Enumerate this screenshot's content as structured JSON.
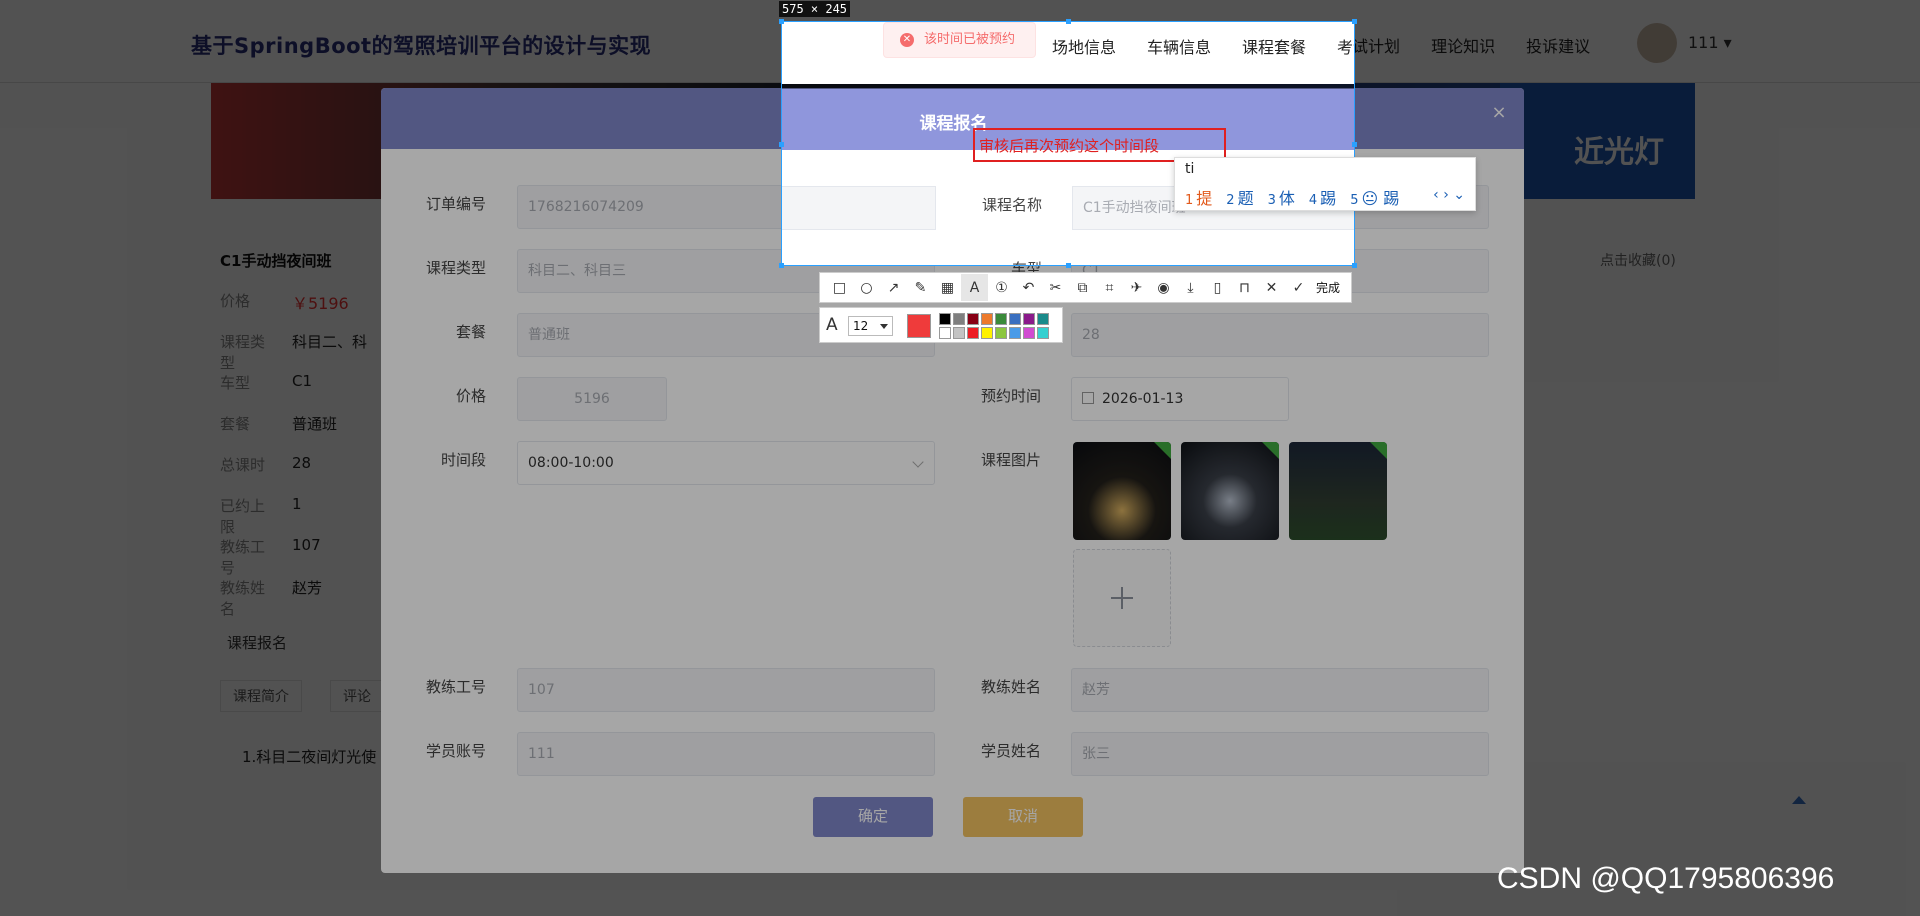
{
  "site": {
    "title": "基于SpringBoot的驾照培训平台的设计与实现",
    "nav": [
      "场地信息",
      "车辆信息",
      "课程套餐",
      "考试计划",
      "理论知识",
      "投诉建议"
    ],
    "user": "111 ▾"
  },
  "banner_text": "近光灯",
  "course": {
    "title": "C1手动挡夜间班",
    "details": [
      {
        "label": "价格",
        "value": "￥5196"
      },
      {
        "label": "课程类型",
        "value": "科目二、科"
      },
      {
        "label": "车型",
        "value": "C1"
      },
      {
        "label": "套餐",
        "value": "普通班"
      },
      {
        "label": "总课时",
        "value": "28"
      },
      {
        "label": "已约上限",
        "value": "1"
      },
      {
        "label": "教练工号",
        "value": "107"
      },
      {
        "label": "教练姓名",
        "value": "赵芳"
      }
    ],
    "section_title": "课程报名",
    "tabs": [
      "课程简介",
      "评论"
    ],
    "desc": "1.科目二夜间灯光使",
    "fav": "点击收藏(0)"
  },
  "dialog": {
    "title": "课程报名",
    "close": "×",
    "fields": {
      "order_no": {
        "label": "订单编号",
        "value": "1768216074209"
      },
      "course_name": {
        "label": "课程名称",
        "value": "C1手动挡夜间班"
      },
      "course_type": {
        "label": "课程类型",
        "value": "科目二、科目三"
      },
      "car_type": {
        "label": "车型",
        "value": "C1"
      },
      "package": {
        "label": "套餐",
        "value": "普通班"
      },
      "hours": {
        "label": "",
        "value": "28"
      },
      "price": {
        "label": "价格",
        "value": "5196"
      },
      "appt_time": {
        "label": "预约时间",
        "value": "2026-01-13"
      },
      "time_slot": {
        "label": "时间段",
        "value": "08:00-10:00"
      },
      "course_img": {
        "label": "课程图片"
      },
      "coach_id": {
        "label": "教练工号",
        "value": "107"
      },
      "coach_name": {
        "label": "教练姓名",
        "value": "赵芳"
      },
      "student_acc": {
        "label": "学员账号",
        "value": "111"
      },
      "student_name": {
        "label": "学员姓名",
        "value": "张三"
      }
    },
    "confirm": "确定",
    "cancel": "取消"
  },
  "toast": {
    "text": "该时间已被预约",
    "icon": "error-icon"
  },
  "screenshot_tool": {
    "size_label": "575 × 245",
    "annotation_text": "审核后再次预约这个时间段",
    "ime": {
      "input": "ti",
      "candidates": [
        {
          "n": "1",
          "text": "提"
        },
        {
          "n": "2",
          "text": "题"
        },
        {
          "n": "3",
          "text": "体"
        },
        {
          "n": "4",
          "text": "踢"
        },
        {
          "n": "5",
          "text": "😐 踢"
        }
      ],
      "nav": "‹ › ⌄"
    },
    "done_label": "完成",
    "font_size": "12",
    "current_color": "#ef3b3b",
    "swatches": [
      "#000000",
      "#7f7f7f",
      "#880015",
      "#ed7a2c",
      "#3a8a3a",
      "#3a6fc0",
      "#8a1a8a",
      "#1a8a8a",
      "#ffffff",
      "#c3c3c3",
      "#ed1c24",
      "#fff200",
      "#8cc63f",
      "#4a9be8",
      "#d14bd1",
      "#35d0d0"
    ]
  },
  "watermark": "CSDN @QQ1795806396"
}
